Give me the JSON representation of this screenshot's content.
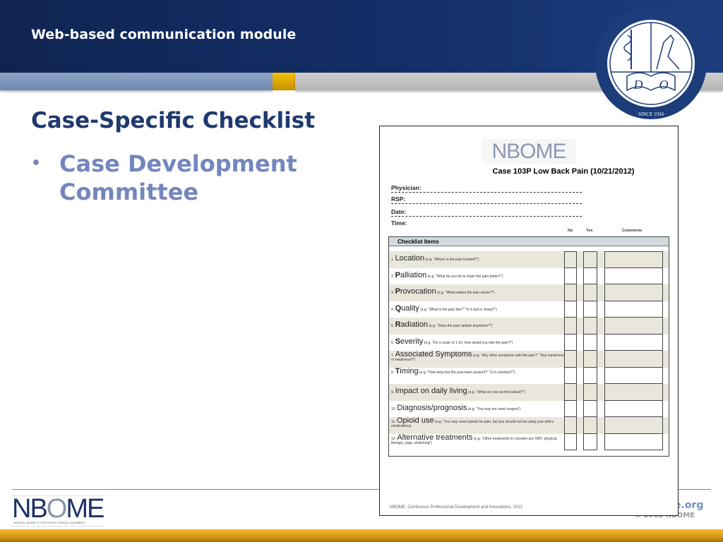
{
  "header": {
    "title": "Web-based communication module",
    "seal_text": "NATIONAL BOARD OF OSTEOPATHIC MEDICAL EXAMINERS · SINCE 1934 · D O"
  },
  "slide": {
    "title": "Case-Specific Checklist",
    "bullet": "•",
    "bullet_text": "Case Development Committee"
  },
  "document": {
    "logo": "NBOME",
    "title": "Case 103P Low Back Pain (10/21/2012)",
    "fields": [
      "Physician:",
      "RSP:",
      "Date:",
      "Time:"
    ],
    "columns": {
      "no": "No",
      "yes": "Yes",
      "comments": "Comments"
    },
    "table_header": "Checklist Items",
    "items": [
      {
        "num": "1.",
        "first": "",
        "rest": "Location",
        "hint": "(e.g. \"Where is the pain located?\")"
      },
      {
        "num": "2.",
        "first": "P",
        "rest": "alliation",
        "hint": "(e.g. \"What do you do to make the pain better?\")"
      },
      {
        "num": "3.",
        "first": "P",
        "rest": "rovocation",
        "hint": "(e.g. \"What makes the pain worse?\")"
      },
      {
        "num": "4.",
        "first": "Q",
        "rest": "uality",
        "hint": "(e.g. \"What is the pain like?\" \"Is it dull or sharp?\")"
      },
      {
        "num": "5.",
        "first": "R",
        "rest": "adiation",
        "hint": "(e.g. \"Does the pain radiate anywhere?\")"
      },
      {
        "num": "6.",
        "first": "S",
        "rest": "everity",
        "hint": "(e.g. \"On a scale of 1-10, how would you rate the pain?\")"
      },
      {
        "num": "7.",
        "first": "",
        "rest": "Associated Symptoms",
        "hint": "(e.g. \"Any other symptoms with the pain?\" \"Any numbness or weakness?\")"
      },
      {
        "num": "8.",
        "first": "T",
        "rest": "iming",
        "hint": "(e.g. \"How long has the pain been present?\" \"Is it constant?\")"
      },
      {
        "num": "9.",
        "first": "",
        "rest": "Impact on daily living",
        "hint": "(e.g. \"What are you worried about?\")"
      },
      {
        "num": "10.",
        "first": "",
        "rest": "Diagnosis/prognosis",
        "hint": "(e.g. \"You may not need surgery\")"
      },
      {
        "num": "11.",
        "first": "",
        "rest": "Opioid use",
        "hint": "(e.g. \"You may need opiods for pain, but you should not be using your wife's medications)"
      },
      {
        "num": "12.",
        "first": "",
        "rest": "Alternative treatments",
        "hint": "(e.g. \"Other treatments to consider are OMT, physical therapy, yoga, stretching\")"
      }
    ],
    "footer": "NBOME, Continuous Professional Development and Innovations, 2012"
  },
  "footer": {
    "logo": "NBOME",
    "logo_sub": "NATIONAL BOARD OF OSTEOPATHIC MEDICAL EXAMINERS",
    "url": "e.org",
    "copyright": "© 2012 NBOME"
  }
}
